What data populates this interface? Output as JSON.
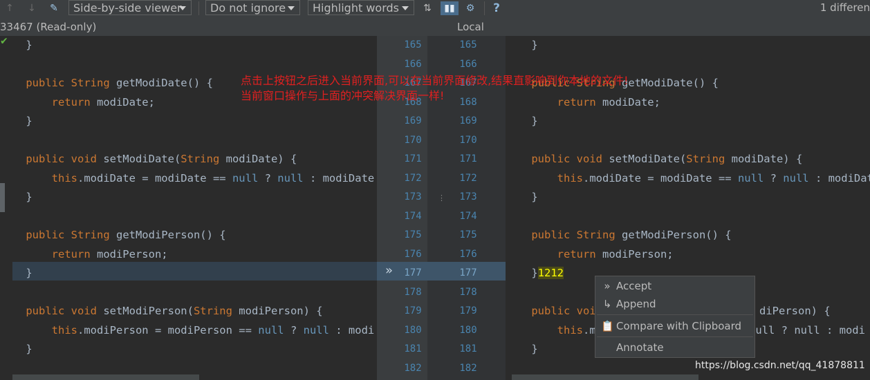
{
  "toolbar": {
    "viewer_label": "Side-by-side viewer",
    "ignore_label": "Do not ignore",
    "highlight_label": "Highlight words",
    "right_text": "1 differen"
  },
  "titles": {
    "left": "33467 (Read-only)",
    "center": "Local"
  },
  "annotation": {
    "line1": "点击上按钮之后进入当前界面,可以在当前界面修改,结果直影响到你本地的文件!",
    "line2": "当前窗口操作与上面的冲突解决界面一样!"
  },
  "left_lines": [
    {
      "row": 0,
      "text": "    }"
    },
    {
      "row": 2,
      "kw": "    public ",
      "ty": "String ",
      "rest": "getModiDate() {"
    },
    {
      "row": 3,
      "kw": "        return ",
      "rest": "modiDate;"
    },
    {
      "row": 4,
      "text": "    }"
    },
    {
      "row": 6,
      "kw": "    public void ",
      "rest": "setModiDate(",
      "ty2": "String ",
      "rest2": "modiDate) {"
    },
    {
      "row": 7,
      "kw": "        this",
      "rest": ".modiDate = modiDate == ",
      "nul": "null",
      "rest2": " ? ",
      "nul2": "null",
      "rest3": " : modiDate"
    },
    {
      "row": 8,
      "text": "    }"
    },
    {
      "row": 10,
      "kw": "    public ",
      "ty": "String ",
      "rest": "getModiPerson() {"
    },
    {
      "row": 11,
      "kw": "        return ",
      "rest": "modiPerson;"
    },
    {
      "row": 12,
      "text": "    }"
    },
    {
      "row": 14,
      "kw": "    public void ",
      "rest": "setModiPerson(",
      "ty2": "String ",
      "rest2": "modiPerson) {"
    },
    {
      "row": 15,
      "kw": "        this",
      "rest": ".modiPerson = modiPerson == ",
      "nul": "null",
      "rest2": " ? ",
      "nul2": "null",
      "rest3": " : modi"
    },
    {
      "row": 16,
      "text": "    }"
    }
  ],
  "right_lines": [
    {
      "row": 0,
      "text": "    }"
    },
    {
      "row": 2,
      "kw": "    public ",
      "ty": "String ",
      "rest": "getModiDate() {"
    },
    {
      "row": 3,
      "kw": "        return ",
      "rest": "modiDate;"
    },
    {
      "row": 4,
      "text": "    }"
    },
    {
      "row": 6,
      "kw": "    public void ",
      "rest": "setModiDate(",
      "ty2": "String ",
      "rest2": "modiDate) {"
    },
    {
      "row": 7,
      "kw": "        this",
      "rest": ".modiDate = modiDate == ",
      "nul": "null",
      "rest2": " ? ",
      "nul2": "null",
      "rest3": " : modiDate"
    },
    {
      "row": 8,
      "text": "    }"
    },
    {
      "row": 10,
      "kw": "    public ",
      "ty": "String ",
      "rest": "getModiPerson() {"
    },
    {
      "row": 11,
      "kw": "        return ",
      "rest": "modiPerson;"
    },
    {
      "row": 12,
      "text": "    }",
      "added": "1212"
    },
    {
      "row": 14,
      "kw": "    public voi",
      "rest": "",
      "tail": "diPerson) {"
    },
    {
      "row": 15,
      "kw": "        this",
      "rest": ".m",
      "tail2": "null ? null : modi"
    },
    {
      "row": 16,
      "text": "    }"
    }
  ],
  "line_numbers": [
    "165",
    "166",
    "167",
    "168",
    "169",
    "170",
    "171",
    "172",
    "173",
    "174",
    "175",
    "176",
    "177",
    "178",
    "179",
    "180",
    "181",
    "182"
  ],
  "current_line": "177",
  "context_menu": {
    "accept": "Accept",
    "append": "Append",
    "compare": "Compare with Clipboard",
    "annotate": "Annotate"
  },
  "watermark": "https://blog.csdn.net/qq_41878811"
}
